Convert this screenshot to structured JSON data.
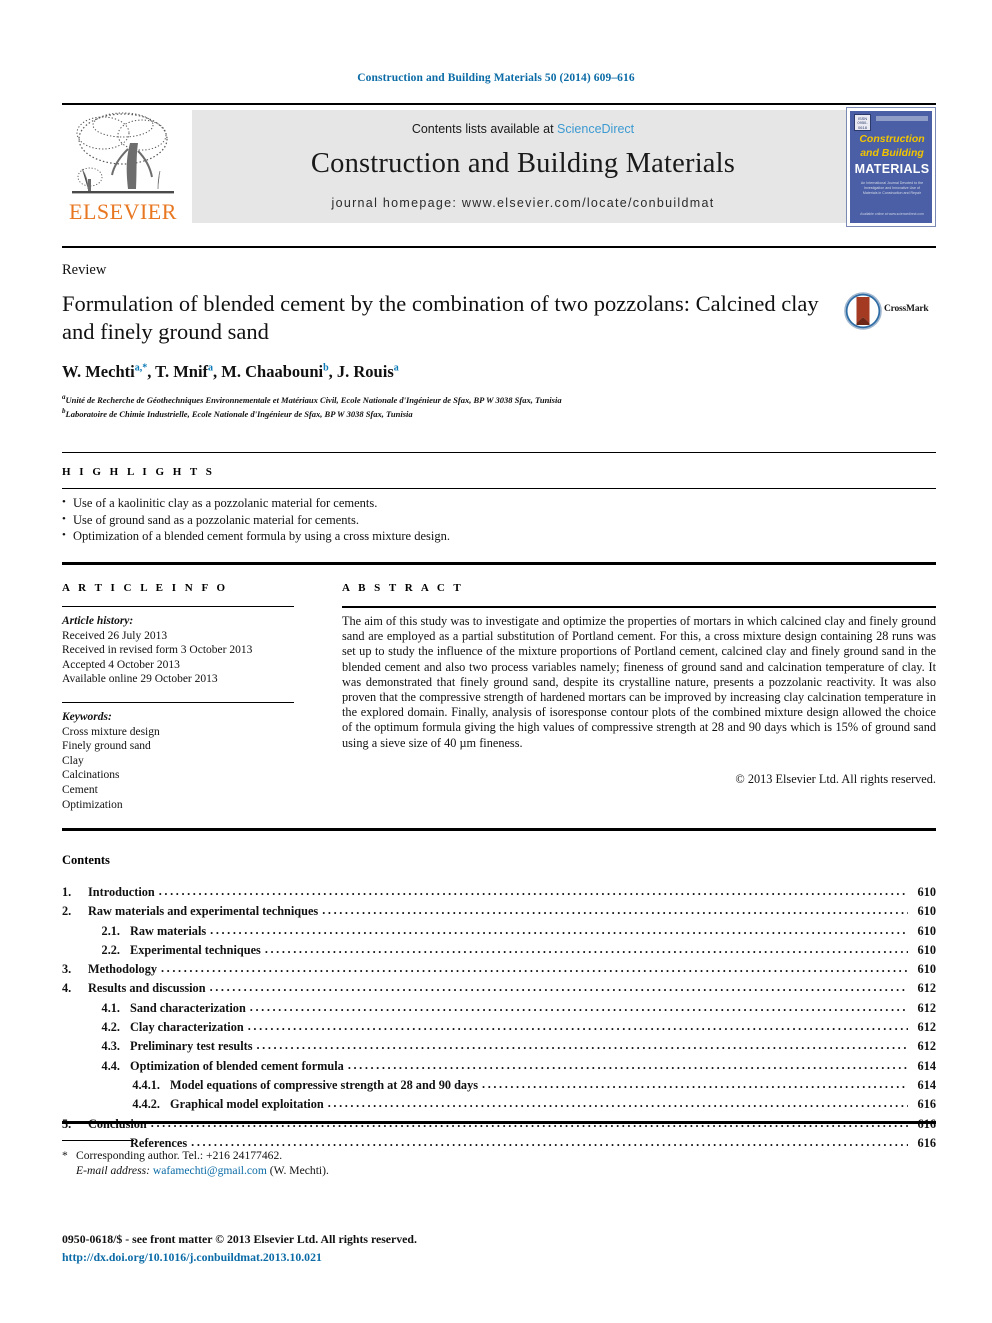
{
  "running_head": "Construction and Building Materials 50 (2014) 609–616",
  "masthead": {
    "publisher_logo_text": "ELSEVIER",
    "contents_prefix": "Contents lists available at ",
    "sciencedirect": "ScienceDirect",
    "journal_title": "Construction and Building Materials",
    "homepage": "journal homepage: www.elsevier.com/locate/conbuildmat",
    "cover": {
      "badge": "ISSN 0950-0618",
      "line1": "Construction",
      "line2": "and Building",
      "line3": "MATERIALS",
      "blurb": "An International Journal Devoted to the Investigation and Innovative Use of Materials in Construction and Repair",
      "footer": "Available online at www.sciencedirect.com"
    }
  },
  "article": {
    "type": "Review",
    "title": "Formulation of blended cement by the combination of two pozzolans: Calcined clay and finely ground sand",
    "crossmark_label": "CrossMark",
    "authors": [
      {
        "name": "W. Mechti",
        "marks": "a,*"
      },
      {
        "name": "T. Mnif",
        "marks": "a"
      },
      {
        "name": "M. Chaabouni",
        "marks": "b"
      },
      {
        "name": "J. Rouis",
        "marks": "a"
      }
    ],
    "affiliations": [
      {
        "mark": "a",
        "text": "Unité de Recherche de Géothechniques Environnementale et Matériaux Civil, Ecole Nationale d'Ingénieur de Sfax, BP W 3038 Sfax, Tunisia"
      },
      {
        "mark": "b",
        "text": "Laboratoire de Chimie Industrielle, Ecole Nationale d'Ingénieur de Sfax, BP W 3038 Sfax, Tunisia"
      }
    ]
  },
  "highlights": {
    "heading": "H I G H L I G H T S",
    "items": [
      "Use of a kaolinitic clay as a pozzolanic material for cements.",
      "Use of ground sand as a pozzolanic material for cements.",
      "Optimization of a blended cement formula by using a cross mixture design."
    ]
  },
  "article_info": {
    "heading": "A R T I C L E    I N F O",
    "history_label": "Article history:",
    "history": [
      "Received 26 July 2013",
      "Received in revised form 3 October 2013",
      "Accepted 4 October 2013",
      "Available online 29 October 2013"
    ],
    "keywords_label": "Keywords:",
    "keywords": [
      "Cross mixture design",
      "Finely ground sand",
      "Clay",
      "Calcinations",
      "Cement",
      "Optimization"
    ]
  },
  "abstract": {
    "heading": "A B S T R A C T",
    "text": "The aim of this study was to investigate and optimize the properties of mortars in which calcined clay and finely ground sand are employed as a partial substitution of Portland cement. For this, a cross mixture design containing 28 runs was set up to study the influence of the mixture proportions of Portland cement, calcined clay and finely ground sand in the blended cement and also two process variables namely; fineness of ground sand and calcination temperature of clay. It was demonstrated that finely ground sand, despite its crystalline nature, presents a pozzolanic reactivity. It was also proven that the compressive strength of hardened mortars can be improved by increasing clay calcination temperature in the explored domain. Finally, analysis of isoresponse contour plots of the combined mixture design allowed the choice of the optimum formula giving the high values of compressive strength at 28 and 90 days which is 15% of ground sand using a sieve size of 40 µm fineness.",
    "copyright": "© 2013 Elsevier Ltd. All rights reserved."
  },
  "contents": {
    "heading": "Contents",
    "rows": [
      {
        "level": 1,
        "num": "1.",
        "label": "Introduction",
        "page": "610"
      },
      {
        "level": 1,
        "num": "2.",
        "label": "Raw materials and experimental techniques",
        "page": "610"
      },
      {
        "level": 2,
        "num": "2.1.",
        "label": "Raw materials",
        "page": "610"
      },
      {
        "level": 2,
        "num": "2.2.",
        "label": "Experimental techniques",
        "page": "610"
      },
      {
        "level": 1,
        "num": "3.",
        "label": "Methodology",
        "page": "610"
      },
      {
        "level": 1,
        "num": "4.",
        "label": "Results and discussion",
        "page": "612"
      },
      {
        "level": 2,
        "num": "4.1.",
        "label": "Sand characterization",
        "page": "612"
      },
      {
        "level": 2,
        "num": "4.2.",
        "label": "Clay characterization",
        "page": "612"
      },
      {
        "level": 2,
        "num": "4.3.",
        "label": "Preliminary test results",
        "page": "612"
      },
      {
        "level": 2,
        "num": "4.4.",
        "label": "Optimization of blended cement formula",
        "page": "614"
      },
      {
        "level": 3,
        "num": "4.4.1.",
        "label": "Model equations of compressive strength at 28 and 90 days",
        "page": "614"
      },
      {
        "level": 3,
        "num": "4.4.2.",
        "label": "Graphical model exploitation",
        "page": "616"
      },
      {
        "level": 1,
        "num": "5.",
        "label": "Conclusion",
        "page": "616"
      },
      {
        "level": 2,
        "num": "",
        "label": "References",
        "page": "616"
      }
    ]
  },
  "footer": {
    "corresponding_star": "*",
    "corresponding_text": "Corresponding author. Tel.: +216 24177462.",
    "email_label": "E-mail address:",
    "email": "wafamechti@gmail.com",
    "email_suffix": "(W. Mechti).",
    "issn_line": "0950-0618/$ - see front matter © 2013 Elsevier Ltd. All rights reserved.",
    "doi": "http://dx.doi.org/10.1016/j.conbuildmat.2013.10.021"
  },
  "colors": {
    "journal_blue": "#0b6ba6",
    "sciencedirect_blue": "#3d9ad1",
    "elsevier_orange": "#E87722",
    "cover_blue": "#4a5fa5",
    "cover_yellow": "#f2c400"
  }
}
